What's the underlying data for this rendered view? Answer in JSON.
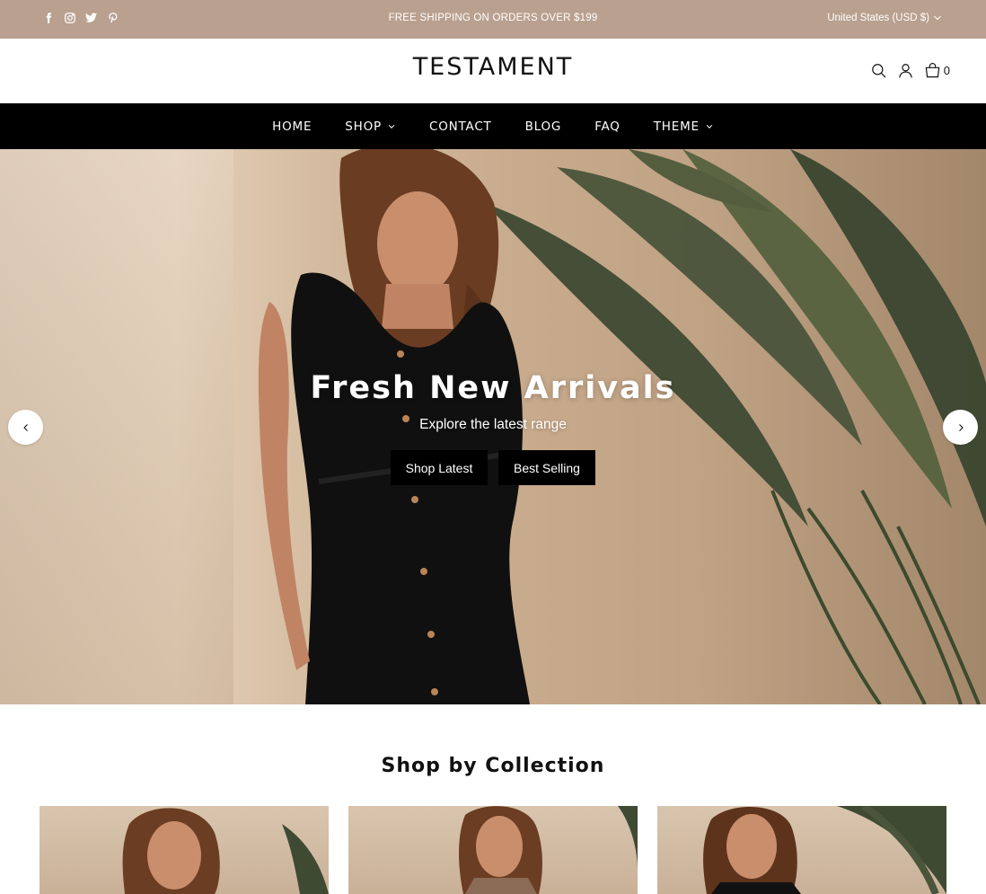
{
  "announcement": {
    "social_icons": [
      "facebook-icon",
      "instagram-icon",
      "twitter-icon",
      "pinterest-icon"
    ],
    "message": "FREE SHIPPING ON ORDERS OVER $199",
    "currency": "United States (USD $)"
  },
  "header": {
    "logo": "TESTAMENT",
    "icons": [
      "search-icon",
      "account-icon",
      "cart-icon"
    ],
    "cart_count": "0"
  },
  "nav": {
    "items": [
      {
        "label": "HOME",
        "dropdown": false
      },
      {
        "label": "SHOP",
        "dropdown": true
      },
      {
        "label": "CONTACT",
        "dropdown": false
      },
      {
        "label": "BLOG",
        "dropdown": false
      },
      {
        "label": "FAQ",
        "dropdown": false
      },
      {
        "label": "THEME",
        "dropdown": true
      }
    ]
  },
  "hero": {
    "title": "Fresh New Arrivals",
    "subtitle": "Explore the latest range",
    "primary_button": "Shop Latest",
    "secondary_button": "Best Selling"
  },
  "collections": {
    "title": "Shop by Collection",
    "cards": 3
  },
  "colors": {
    "announcement_bg": "#b9a08f",
    "nav_bg": "#000000",
    "button_bg": "#000000"
  }
}
